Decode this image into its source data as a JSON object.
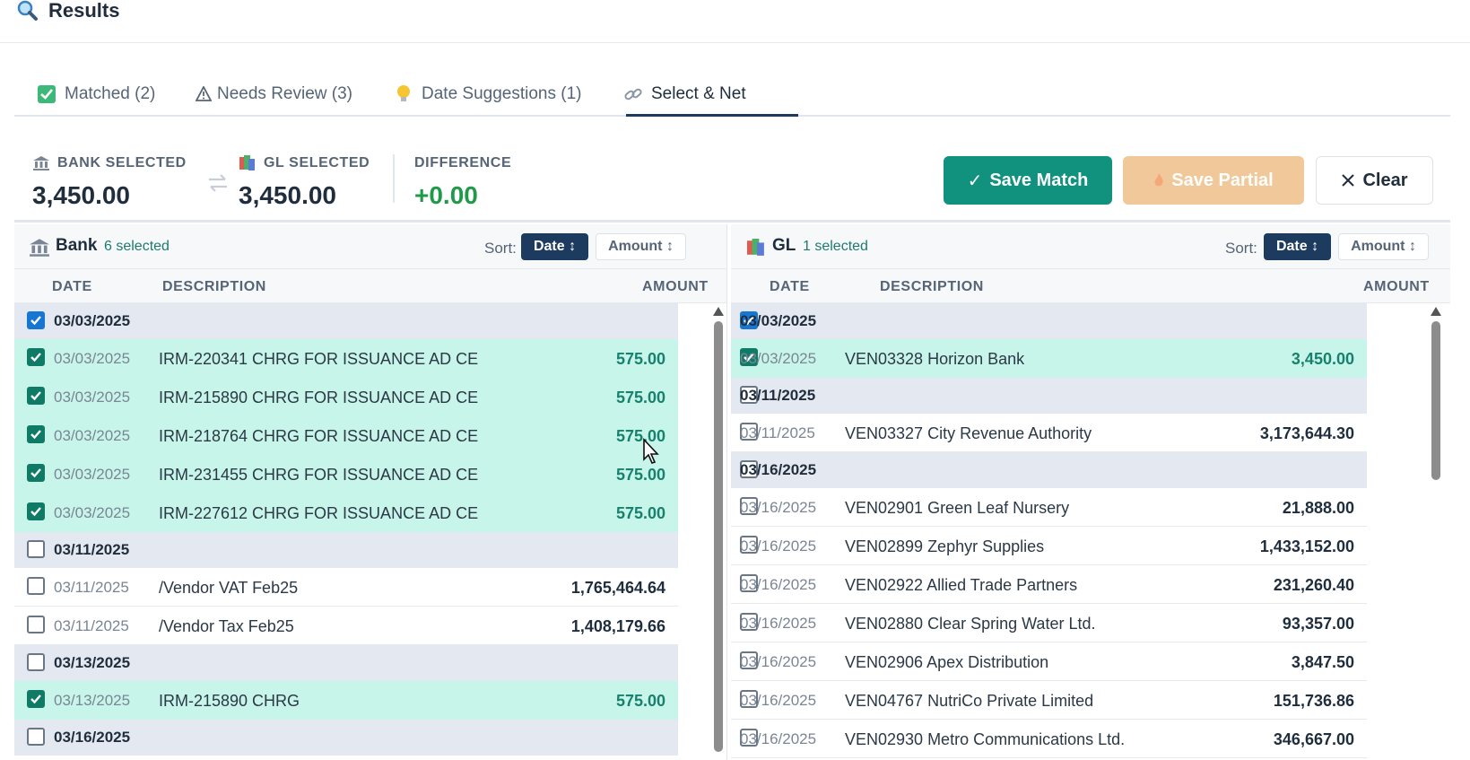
{
  "header": {
    "title": "Results",
    "icon": "magnifier-icon"
  },
  "tabs": [
    {
      "label": "Matched (2)",
      "icon": "check-square-icon"
    },
    {
      "label": "Needs Review (3)",
      "icon": "warning-icon"
    },
    {
      "label": "Date Suggestions (1)",
      "icon": "lightbulb-icon"
    },
    {
      "label": "Select & Net",
      "icon": "link-icon"
    }
  ],
  "summary": {
    "bank_label": "BANK SELECTED",
    "bank_value": "3,450.00",
    "gl_label": "GL SELECTED",
    "gl_value": "3,450.00",
    "diff_label": "DIFFERENCE",
    "diff_value": "+0.00",
    "save_match": "Save Match",
    "save_partial": "Save Partial",
    "clear": "Clear",
    "colors": {
      "save_match": "#10927f",
      "save_partial": "#f0c89a",
      "difference": "#1e9a4a"
    }
  },
  "bank": {
    "title": "Bank",
    "count": "6 selected",
    "sort_label": "Sort:",
    "sort_date": "Date ↕",
    "sort_amount": "Amount ↕",
    "columns": {
      "date": "DATE",
      "description": "DESCRIPTION",
      "amount": "AMOUNT"
    },
    "rows": [
      {
        "type": "group",
        "date": "03/03/2025",
        "checked": true
      },
      {
        "type": "data",
        "date": "03/03/2025",
        "desc": "IRM-220341 CHRG FOR ISSUANCE AD CE",
        "amount": "575.00",
        "checked": true
      },
      {
        "type": "data",
        "date": "03/03/2025",
        "desc": "IRM-215890 CHRG FOR ISSUANCE AD CE",
        "amount": "575.00",
        "checked": true
      },
      {
        "type": "data",
        "date": "03/03/2025",
        "desc": "IRM-218764 CHRG FOR ISSUANCE AD CE",
        "amount": "575.00",
        "checked": true
      },
      {
        "type": "data",
        "date": "03/03/2025",
        "desc": "IRM-231455 CHRG FOR ISSUANCE AD CE",
        "amount": "575.00",
        "checked": true
      },
      {
        "type": "data",
        "date": "03/03/2025",
        "desc": "IRM-227612 CHRG FOR ISSUANCE AD CE",
        "amount": "575.00",
        "checked": true
      },
      {
        "type": "group",
        "date": "03/11/2025",
        "checked": false
      },
      {
        "type": "data",
        "date": "03/11/2025",
        "desc": "/Vendor VAT Feb25",
        "amount": "1,765,464.64",
        "checked": false
      },
      {
        "type": "data",
        "date": "03/11/2025",
        "desc": "/Vendor Tax Feb25",
        "amount": "1,408,179.66",
        "checked": false
      },
      {
        "type": "group",
        "date": "03/13/2025",
        "checked": false
      },
      {
        "type": "data",
        "date": "03/13/2025",
        "desc": "IRM-215890 CHRG",
        "amount": "575.00",
        "checked": true
      },
      {
        "type": "group",
        "date": "03/16/2025",
        "checked": false
      }
    ]
  },
  "gl": {
    "title": "GL",
    "count": "1 selected",
    "sort_label": "Sort:",
    "sort_date": "Date ↕",
    "sort_amount": "Amount ↕",
    "columns": {
      "date": "DATE",
      "description": "DESCRIPTION",
      "amount": "AMOUNT"
    },
    "rows": [
      {
        "type": "group",
        "date": "03/03/2025",
        "checked": true
      },
      {
        "type": "data",
        "date": "03/03/2025",
        "desc": "VEN03328 Horizon Bank",
        "amount": "3,450.00",
        "checked": true
      },
      {
        "type": "group",
        "date": "03/11/2025",
        "checked": false
      },
      {
        "type": "data",
        "date": "03/11/2025",
        "desc": "VEN03327 City Revenue Authority",
        "amount": "3,173,644.30",
        "checked": false
      },
      {
        "type": "group",
        "date": "03/16/2025",
        "checked": false
      },
      {
        "type": "data",
        "date": "03/16/2025",
        "desc": "VEN02901 Green Leaf Nursery",
        "amount": "21,888.00",
        "checked": false
      },
      {
        "type": "data",
        "date": "03/16/2025",
        "desc": "VEN02899 Zephyr Supplies",
        "amount": "1,433,152.00",
        "checked": false
      },
      {
        "type": "data",
        "date": "03/16/2025",
        "desc": "VEN02922 Allied Trade Partners",
        "amount": "231,260.40",
        "checked": false
      },
      {
        "type": "data",
        "date": "03/16/2025",
        "desc": "VEN02880 Clear Spring Water Ltd.",
        "amount": "93,357.00",
        "checked": false
      },
      {
        "type": "data",
        "date": "03/16/2025",
        "desc": "VEN02906 Apex Distribution",
        "amount": "3,847.50",
        "checked": false
      },
      {
        "type": "data",
        "date": "03/16/2025",
        "desc": "VEN04767 NutriCo Private Limited",
        "amount": "151,736.86",
        "checked": false
      },
      {
        "type": "data",
        "date": "03/16/2025",
        "desc": "VEN02930 Metro Communications Ltd.",
        "amount": "346,667.00",
        "checked": false
      }
    ]
  }
}
